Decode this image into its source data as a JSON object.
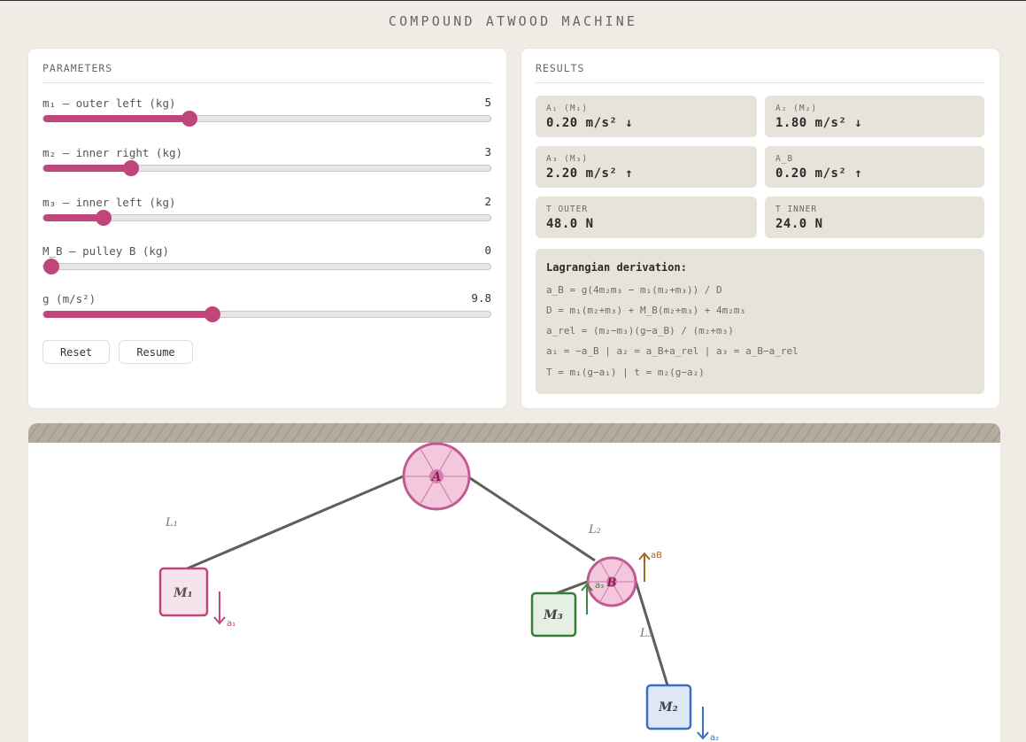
{
  "app": {
    "title": "COMPOUND ATWOOD MACHINE"
  },
  "parameters": {
    "heading": "PARAMETERS",
    "sliders": [
      {
        "label": "m₁ — outer left (kg)",
        "value": "5",
        "level": 0.32
      },
      {
        "label": "m₂ — inner right (kg)",
        "value": "3",
        "level": 0.185
      },
      {
        "label": "m₃ — inner left (kg)",
        "value": "2",
        "level": 0.12
      },
      {
        "label": "M_B — pulley B (kg)",
        "value": "0",
        "level": 0.0
      },
      {
        "label": "g (m/s²)",
        "value": "9.8",
        "level": 0.372
      }
    ],
    "reset_label": "Reset",
    "resume_label": "Resume"
  },
  "results": {
    "heading": "RESULTS",
    "cards": [
      {
        "key": "A₁ (M₁)",
        "value": "0.20 m/s² ↓"
      },
      {
        "key": "A₂ (M₂)",
        "value": "1.80 m/s² ↓"
      },
      {
        "key": "A₃ (M₃)",
        "value": "2.20 m/s² ↑"
      },
      {
        "key": "A_B",
        "value": "0.20 m/s² ↑"
      },
      {
        "key": "T OUTER",
        "value": "48.0 N"
      },
      {
        "key": "T INNER",
        "value": "24.0 N"
      }
    ],
    "derivation": {
      "heading": "Lagrangian derivation:",
      "lines": [
        "a_B = g(4m₂m₃ − m₁(m₂+m₃)) / D",
        "D = m₁(m₂+m₃) + M_B(m₂+m₃) + 4m₂m₃",
        "a_rel = (m₂−m₃)(g−a_B) / (m₂+m₃)",
        "a₁ = −a_B  |  a₂ = a_B+a_rel  |  a₃ = a_B−a_rel",
        "T = m₁(g−a₁)  |  t = m₂(g−a₂)"
      ]
    }
  },
  "scene": {
    "pulley_a": "A",
    "pulley_b": "B",
    "mass_1": "M₁",
    "mass_2": "M₂",
    "mass_3": "M₃",
    "rope_1": "L₁",
    "rope_2": "L₂",
    "rope_3": "L₃",
    "accel_1": "a₁",
    "accel_2": "a₂",
    "accel_3": "a₃",
    "accel_b": "aB",
    "colors": {
      "pulley": "#c05a93",
      "mass1": "#c0457a",
      "mass2": "#3a6fc4",
      "mass3": "#3a7a3a",
      "accel_b": "#a06a20",
      "rope": "#5f5f58",
      "ceiling": "#b3ab9e"
    }
  }
}
